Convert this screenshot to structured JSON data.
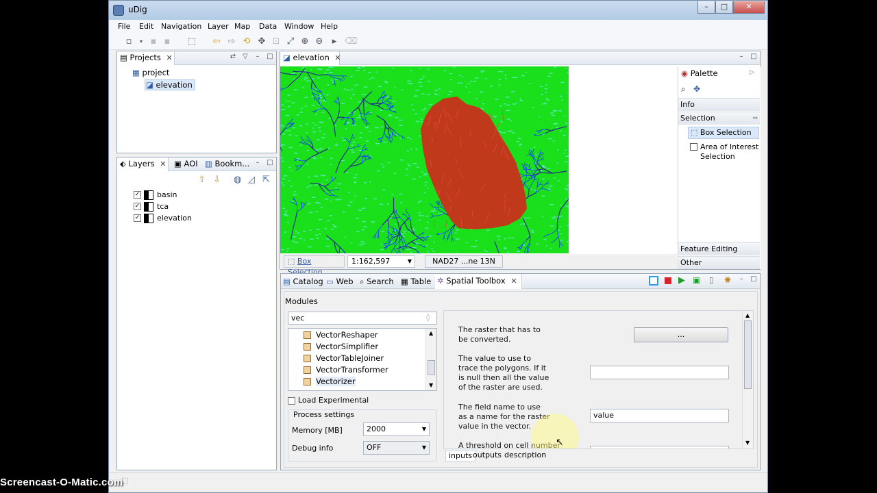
{
  "window": {
    "title": "uDig",
    "controls": [
      "–",
      "□",
      "✕"
    ]
  },
  "menu": [
    "File",
    "Edit",
    "Navigation",
    "Layer",
    "Map",
    "Data",
    "Window",
    "Help"
  ],
  "projects": {
    "tab": "Projects",
    "tree": [
      {
        "label": "project"
      },
      {
        "label": "elevation"
      }
    ]
  },
  "layers_panel": {
    "tabs": [
      "Layers",
      "AOI",
      "Bookm..."
    ],
    "layers": [
      "basin",
      "tca",
      "elevation"
    ]
  },
  "editor": {
    "tab": "elevation"
  },
  "status": {
    "box_selection": "Box Selection",
    "scale": "1:162,597",
    "crs": "NAD27 ...ne 13N"
  },
  "palette": {
    "title": "Palette",
    "sections": {
      "info": "Info",
      "selection": "Selection",
      "feature_editing": "Feature Editing",
      "other": "Other"
    },
    "tools": [
      "Box Selection",
      "Area of Interest Selection"
    ]
  },
  "bottom_tabs": [
    "Catalog",
    "Web",
    "Search",
    "Table",
    "Spatial Toolbox"
  ],
  "toolbox": {
    "modules_label": "Modules",
    "filter_value": "vec",
    "modules": [
      "VectorReshaper",
      "VectorSimplifier",
      "VectorTableJoiner",
      "VectorTransformer",
      "Vectorizer"
    ],
    "load_experimental": "Load Experimental",
    "process_settings": "Process settings",
    "memory_label": "Memory [MB]",
    "memory_value": "2000",
    "debug_label": "Debug info",
    "debug_value": "OFF",
    "params": [
      {
        "desc": "The raster that has to be converted.",
        "value": "..."
      },
      {
        "desc": "The value to use to trace the polygons. If it is null then all the value of the raster are used.",
        "value": ""
      },
      {
        "desc": "The field name to use as a name for the raster value in the vector.",
        "value": "value"
      },
      {
        "desc": "A threshold on cell number",
        "value": ""
      }
    ],
    "subtabs": [
      "inputs",
      "outputs",
      "description"
    ]
  },
  "watermark": "Screencast-O-Matic.com",
  "colors": {
    "map_green": "#19e01b",
    "drainage_blue": "#1a3cff",
    "basin_red": "#c0391b",
    "titlebar": "#bcd1ea"
  }
}
